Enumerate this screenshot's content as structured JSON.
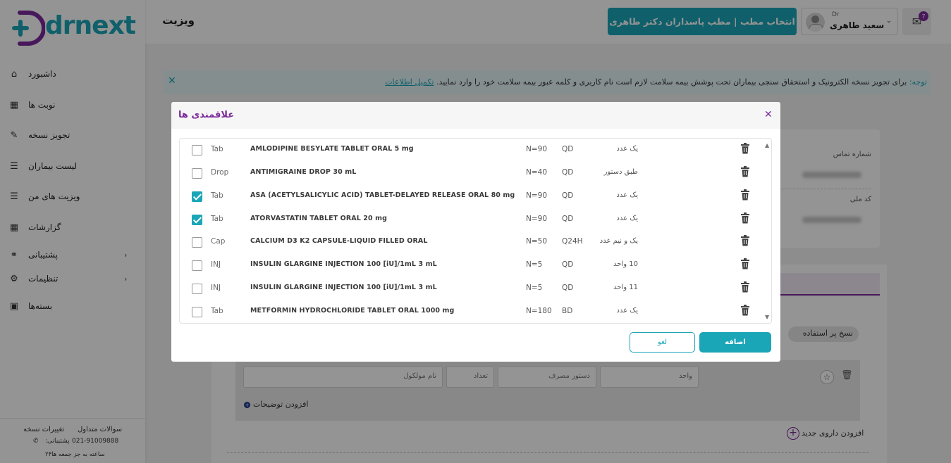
{
  "header": {
    "page_title": "ویزیت",
    "clinic_button": "انتخاب مطب | مطب پاسداران دکتر طاهری",
    "user_prefix": "Dr",
    "user_name": "سعید طاهری",
    "mail_badge": "7"
  },
  "notice": {
    "label": "توجه:",
    "text": " برای تجویز نسخه الکترونیک و استحقاق سنجی بیماران تحت پوشش بیمه سلامت لازم است نام کاربری و کلمه عبور بیمه سلامت خود را وارد نمایید. ",
    "link": "تکمیل اطلاعات"
  },
  "patient_card": {
    "phone_label": "شماره تماس",
    "national_code_label": "کد ملی"
  },
  "background_form": {
    "used_prescriptions": "نسخ پر استفاده",
    "unit_placeholder": "واحد",
    "usage_placeholder": "دستور مصرف",
    "count_placeholder": "تعداد",
    "molecule_placeholder": "نام مولکول",
    "add_description": "افزودن توضیحات",
    "add_new_drug": "افزودن داروی جدید"
  },
  "sidebar": {
    "logo_text": "drnext",
    "items": [
      {
        "label": "داشبورد",
        "icon": "home-icon"
      },
      {
        "label": "نوبت ها",
        "icon": "calendar-icon"
      },
      {
        "label": "تجویز نسخه",
        "icon": "edit-icon"
      },
      {
        "label": "لیست بیماران",
        "icon": "list-icon"
      },
      {
        "label": "ویزیت های من",
        "icon": "list-icon"
      },
      {
        "label": "گزارشات",
        "icon": "calendar-icon"
      },
      {
        "label": "پشتیبانی",
        "icon": "headset-icon"
      },
      {
        "label": "تنظیمات",
        "icon": "gear-icon"
      },
      {
        "label": "بسته‌ها",
        "icon": "box-icon"
      }
    ],
    "footer": {
      "faq": "سوالات متداول",
      "changes": "تغییرات نسخه",
      "phone": "021-91009888",
      "support_label": ":پشتیبانی",
      "hours": "۲۴ساعته به جز جمعه ها"
    }
  },
  "modal": {
    "title": "علاقمندی ها",
    "add_button": "اضافه",
    "cancel_button": "لغو",
    "rows": [
      {
        "checked": false,
        "form": "Tab",
        "name": "AMLODIPINE BESYLATE TABLET ORAL 5 mg",
        "n": "N=90",
        "freq": "QD",
        "dose": "یک عدد"
      },
      {
        "checked": false,
        "form": "Drop",
        "name": "ANTIMIGRAINE DROP 30 mL",
        "n": "N=40",
        "freq": "QD",
        "dose": "طبق دستور"
      },
      {
        "checked": true,
        "form": "Tab",
        "name": "ASA (ACETYLSALICYLIC ACID) TABLET-DELAYED RELEASE ORAL 80 mg",
        "n": "N=90",
        "freq": "QD",
        "dose": "یک عدد"
      },
      {
        "checked": true,
        "form": "Tab",
        "name": "ATORVASTATIN TABLET ORAL 20 mg",
        "n": "N=90",
        "freq": "QD",
        "dose": "یک عدد"
      },
      {
        "checked": false,
        "form": "Cap",
        "name": "CALCIUM D3 K2 CAPSULE-LIQUID FILLED ORAL",
        "n": "N=50",
        "freq": "Q24H",
        "dose": "یک و نیم عدد"
      },
      {
        "checked": false,
        "form": "INJ",
        "name": "INSULIN GLARGINE INJECTION 100 [iU]/1mL 3 mL",
        "n": "N=5",
        "freq": "QD",
        "dose": "10 واحد"
      },
      {
        "checked": false,
        "form": "INJ",
        "name": "INSULIN GLARGINE INJECTION 100 [iU]/1mL 3 mL",
        "n": "N=5",
        "freq": "QD",
        "dose": "11 واحد"
      },
      {
        "checked": false,
        "form": "Tab",
        "name": "METFORMIN HYDROCHLORIDE TABLET ORAL 1000 mg",
        "n": "N=180",
        "freq": "BD",
        "dose": "یک عدد"
      }
    ]
  },
  "colors": {
    "accent": "#1aa6b7",
    "brand_purple": "#7b2a9b"
  }
}
